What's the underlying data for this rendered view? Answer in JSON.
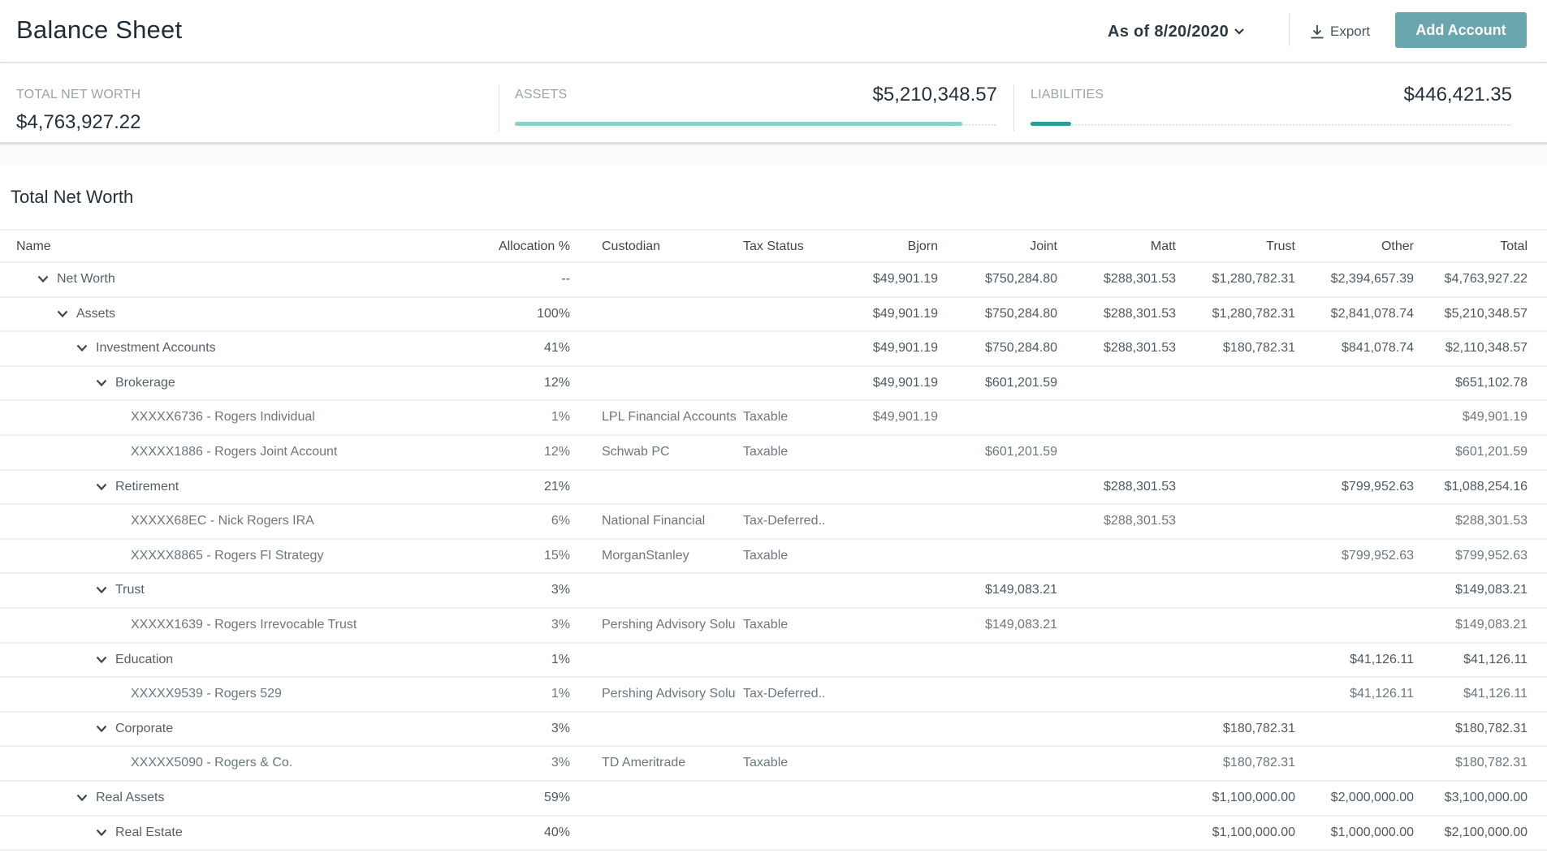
{
  "header": {
    "title": "Balance Sheet",
    "date_select": "As of 8/20/2020",
    "export_label": "Export",
    "add_account_label": "Add Account"
  },
  "summary": {
    "net_worth": {
      "label": "TOTAL NET WORTH",
      "value": "$4,763,927.22"
    },
    "assets": {
      "label": "ASSETS",
      "value": "$5,210,348.57",
      "bar_fraction": 0.93,
      "color": "#8fcfc6"
    },
    "liabilities": {
      "label": "LIABILITIES",
      "value": "$446,421.35",
      "bar_fraction": 0.085,
      "color": "#2a9d95"
    }
  },
  "section": {
    "title": "Total Net Worth"
  },
  "table": {
    "columns": {
      "name": "Name",
      "alloc": "Allocation %",
      "cust": "Custodian",
      "tax": "Tax Status",
      "bjorn": "Bjorn",
      "joint": "Joint",
      "matt": "Matt",
      "trust": "Trust",
      "other": "Other",
      "total": "Total"
    },
    "rows": [
      {
        "level": 1,
        "group": true,
        "name": "Net Worth",
        "alloc": "--",
        "cust": "",
        "tax": "",
        "bjorn": "$49,901.19",
        "joint": "$750,284.80",
        "matt": "$288,301.53",
        "trust": "$1,280,782.31",
        "other": "$2,394,657.39",
        "total": "$4,763,927.22"
      },
      {
        "level": 2,
        "group": true,
        "name": "Assets",
        "alloc": "100%",
        "cust": "",
        "tax": "",
        "bjorn": "$49,901.19",
        "joint": "$750,284.80",
        "matt": "$288,301.53",
        "trust": "$1,280,782.31",
        "other": "$2,841,078.74",
        "total": "$5,210,348.57"
      },
      {
        "level": 3,
        "group": true,
        "name": "Investment Accounts",
        "alloc": "41%",
        "cust": "",
        "tax": "",
        "bjorn": "$49,901.19",
        "joint": "$750,284.80",
        "matt": "$288,301.53",
        "trust": "$180,782.31",
        "other": "$841,078.74",
        "total": "$2,110,348.57"
      },
      {
        "level": 4,
        "group": true,
        "name": "Brokerage",
        "alloc": "12%",
        "cust": "",
        "tax": "",
        "bjorn": "$49,901.19",
        "joint": "$601,201.59",
        "matt": "",
        "trust": "",
        "other": "",
        "total": "$651,102.78"
      },
      {
        "level": 5,
        "group": false,
        "name": "XXXXX6736 - Rogers Individual",
        "alloc": "1%",
        "cust": "LPL Financial Accounts",
        "tax": "Taxable",
        "bjorn": "$49,901.19",
        "joint": "",
        "matt": "",
        "trust": "",
        "other": "",
        "total": "$49,901.19"
      },
      {
        "level": 5,
        "group": false,
        "name": "XXXXX1886 - Rogers Joint Account",
        "alloc": "12%",
        "cust": "Schwab PC",
        "tax": "Taxable",
        "bjorn": "",
        "joint": "$601,201.59",
        "matt": "",
        "trust": "",
        "other": "",
        "total": "$601,201.59"
      },
      {
        "level": 4,
        "group": true,
        "name": "Retirement",
        "alloc": "21%",
        "cust": "",
        "tax": "",
        "bjorn": "",
        "joint": "",
        "matt": "$288,301.53",
        "trust": "",
        "other": "$799,952.63",
        "total": "$1,088,254.16"
      },
      {
        "level": 5,
        "group": false,
        "name": "XXXXX68EC - Nick Rogers IRA",
        "alloc": "6%",
        "cust": "National Financial",
        "tax": "Tax-Deferred..",
        "bjorn": "",
        "joint": "",
        "matt": "$288,301.53",
        "trust": "",
        "other": "",
        "total": "$288,301.53"
      },
      {
        "level": 5,
        "group": false,
        "name": "XXXXX8865 - Rogers FI Strategy",
        "alloc": "15%",
        "cust": "MorganStanley",
        "tax": "Taxable",
        "bjorn": "",
        "joint": "",
        "matt": "",
        "trust": "",
        "other": "$799,952.63",
        "total": "$799,952.63"
      },
      {
        "level": 4,
        "group": true,
        "name": "Trust",
        "alloc": "3%",
        "cust": "",
        "tax": "",
        "bjorn": "",
        "joint": "$149,083.21",
        "matt": "",
        "trust": "",
        "other": "",
        "total": "$149,083.21"
      },
      {
        "level": 5,
        "group": false,
        "name": "XXXXX1639 - Rogers Irrevocable Trust",
        "alloc": "3%",
        "cust": "Pershing Advisory Solutions",
        "tax": "Taxable",
        "bjorn": "",
        "joint": "$149,083.21",
        "matt": "",
        "trust": "",
        "other": "",
        "total": "$149,083.21"
      },
      {
        "level": 4,
        "group": true,
        "name": "Education",
        "alloc": "1%",
        "cust": "",
        "tax": "",
        "bjorn": "",
        "joint": "",
        "matt": "",
        "trust": "",
        "other": "$41,126.11",
        "total": "$41,126.11"
      },
      {
        "level": 5,
        "group": false,
        "name": "XXXXX9539 - Rogers 529",
        "alloc": "1%",
        "cust": "Pershing Advisory Solutions",
        "tax": "Tax-Deferred..",
        "bjorn": "",
        "joint": "",
        "matt": "",
        "trust": "",
        "other": "$41,126.11",
        "total": "$41,126.11"
      },
      {
        "level": 4,
        "group": true,
        "name": "Corporate",
        "alloc": "3%",
        "cust": "",
        "tax": "",
        "bjorn": "",
        "joint": "",
        "matt": "",
        "trust": "$180,782.31",
        "other": "",
        "total": "$180,782.31"
      },
      {
        "level": 5,
        "group": false,
        "name": "XXXXX5090 - Rogers & Co.",
        "alloc": "3%",
        "cust": "TD Ameritrade",
        "tax": "Taxable",
        "bjorn": "",
        "joint": "",
        "matt": "",
        "trust": "$180,782.31",
        "other": "",
        "total": "$180,782.31"
      },
      {
        "level": 3,
        "group": true,
        "name": "Real Assets",
        "alloc": "59%",
        "cust": "",
        "tax": "",
        "bjorn": "",
        "joint": "",
        "matt": "",
        "trust": "$1,100,000.00",
        "other": "$2,000,000.00",
        "total": "$3,100,000.00"
      },
      {
        "level": 4,
        "group": true,
        "name": "Real Estate",
        "alloc": "40%",
        "cust": "",
        "tax": "",
        "bjorn": "",
        "joint": "",
        "matt": "",
        "trust": "$1,100,000.00",
        "other": "$1,000,000.00",
        "total": "$2,100,000.00"
      }
    ]
  }
}
